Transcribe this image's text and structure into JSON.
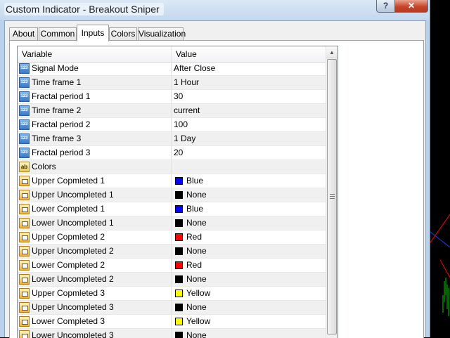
{
  "window": {
    "title": "Custom Indicator - Breakout Sniper",
    "help_label": "?",
    "close_label": "✕"
  },
  "tabs": [
    {
      "label": "About"
    },
    {
      "label": "Common"
    },
    {
      "label": "Inputs",
      "active": true
    },
    {
      "label": "Colors"
    },
    {
      "label": "Visualization"
    }
  ],
  "grid": {
    "columns": {
      "variable": "Variable",
      "value": "Value"
    },
    "rows": [
      {
        "type": "number",
        "icon": "numeric-type-icon",
        "icon_text": "123",
        "variable": "Signal Mode",
        "value": "After Close"
      },
      {
        "type": "number",
        "icon": "numeric-type-icon",
        "icon_text": "123",
        "variable": "Time frame 1",
        "value": "1 Hour"
      },
      {
        "type": "number",
        "icon": "numeric-type-icon",
        "icon_text": "123",
        "variable": "Fractal period 1",
        "value": "30"
      },
      {
        "type": "number",
        "icon": "numeric-type-icon",
        "icon_text": "123",
        "variable": "Time frame 2",
        "value": "current"
      },
      {
        "type": "number",
        "icon": "numeric-type-icon",
        "icon_text": "123",
        "variable": "Fractal period 2",
        "value": "100"
      },
      {
        "type": "number",
        "icon": "numeric-type-icon",
        "icon_text": "123",
        "variable": "Time frame 3",
        "value": "1 Day"
      },
      {
        "type": "number",
        "icon": "numeric-type-icon",
        "icon_text": "123",
        "variable": "Fractal period 3",
        "value": "20"
      },
      {
        "type": "string",
        "icon": "string-type-icon",
        "icon_text": "ab",
        "variable": "Colors",
        "value": ""
      },
      {
        "type": "color",
        "icon": "color-type-icon",
        "variable": "Upper Copmleted 1",
        "value": "Blue",
        "swatch": "#0000ff"
      },
      {
        "type": "color",
        "icon": "color-type-icon",
        "variable": "Upper Uncompleted 1",
        "value": "None",
        "swatch": "#000000"
      },
      {
        "type": "color",
        "icon": "color-type-icon",
        "variable": "Lower Completed 1",
        "value": "Blue",
        "swatch": "#0000ff"
      },
      {
        "type": "color",
        "icon": "color-type-icon",
        "variable": "Lower Uncompleted 1",
        "value": "None",
        "swatch": "#000000"
      },
      {
        "type": "color",
        "icon": "color-type-icon",
        "variable": "Upper Copmleted 2",
        "value": "Red",
        "swatch": "#ff0000"
      },
      {
        "type": "color",
        "icon": "color-type-icon",
        "variable": "Upper Uncompleted 2",
        "value": "None",
        "swatch": "#000000"
      },
      {
        "type": "color",
        "icon": "color-type-icon",
        "variable": "Lower Completed 2",
        "value": "Red",
        "swatch": "#ff0000"
      },
      {
        "type": "color",
        "icon": "color-type-icon",
        "variable": "Lower Uncompleted 2",
        "value": "None",
        "swatch": "#000000"
      },
      {
        "type": "color",
        "icon": "color-type-icon",
        "variable": "Upper Copmleted 3",
        "value": "Yellow",
        "swatch": "#ffff00"
      },
      {
        "type": "color",
        "icon": "color-type-icon",
        "variable": "Upper Uncompleted 3",
        "value": "None",
        "swatch": "#000000"
      },
      {
        "type": "color",
        "icon": "color-type-icon",
        "variable": "Lower Completed 3",
        "value": "Yellow",
        "swatch": "#ffff00"
      },
      {
        "type": "color",
        "icon": "color-type-icon",
        "variable": "Lower Uncompleted 3",
        "value": "None",
        "swatch": "#000000"
      }
    ]
  },
  "colors": {
    "background_chart": "#000000",
    "window_frame": "#b9d1ea",
    "row_alt": "#f0f0f0",
    "close_button": "#c8452b"
  }
}
